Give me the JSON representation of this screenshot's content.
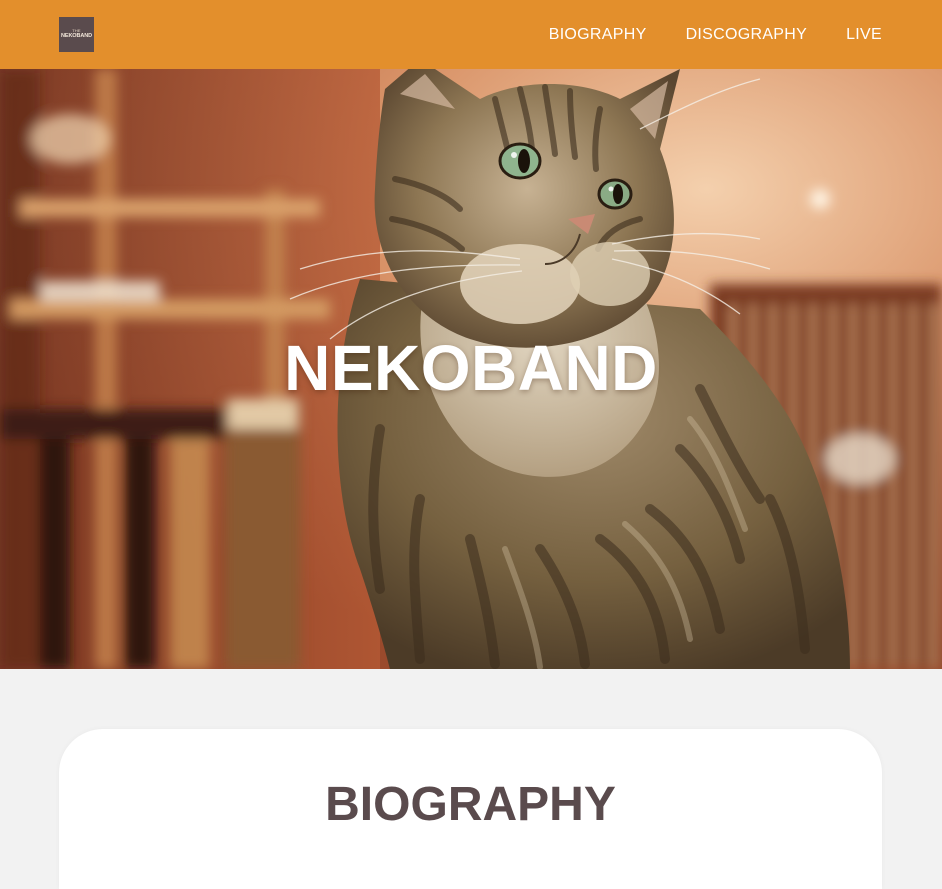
{
  "header": {
    "logo": {
      "small_text": "THE",
      "text": "NEKOBAND"
    },
    "nav": [
      {
        "label": "BIOGRAPHY"
      },
      {
        "label": "DISCOGRAPHY"
      },
      {
        "label": "LIVE"
      }
    ]
  },
  "hero": {
    "title": "NEKOBAND",
    "image": "tabby-cat-photo"
  },
  "biography": {
    "title": "BIOGRAPHY"
  },
  "colors": {
    "header_bg": "#e38f2c",
    "logo_bg": "#5a4b4d",
    "heading_text": "#5a4b4d",
    "page_bg": "#f2f2f2",
    "card_bg": "#ffffff"
  }
}
